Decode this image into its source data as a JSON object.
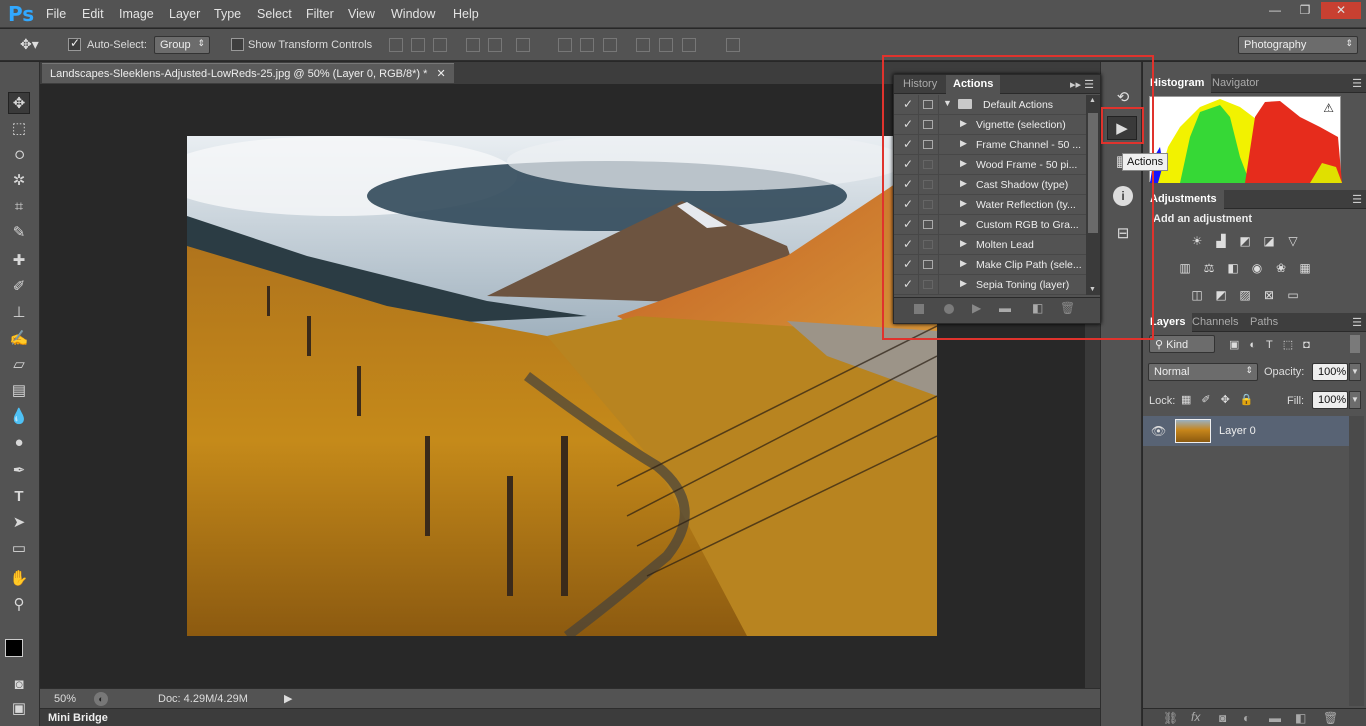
{
  "app": {
    "logo": "Ps",
    "window_controls": [
      "—",
      "❐",
      "✕"
    ]
  },
  "menubar": {
    "items": [
      "File",
      "Edit",
      "Image",
      "Layer",
      "Type",
      "Select",
      "Filter",
      "View",
      "Window",
      "Help"
    ]
  },
  "options": {
    "auto_select_label": "Auto-Select:",
    "auto_select_value": "Group",
    "transform_label": "Show Transform Controls",
    "workspace": "Photography"
  },
  "document": {
    "tab_title": "Landscapes-Sleeklens-Adjusted-LowReds-25.jpg @ 50% (Layer 0, RGB/8*) *",
    "zoom": "50%",
    "doc_info": "Doc: 4.29M/4.29M"
  },
  "bottom": {
    "mini_bridge": "Mini Bridge"
  },
  "actions_panel": {
    "tabs": [
      "History",
      "Actions"
    ],
    "set_name": "Default Actions",
    "items": [
      {
        "label": "Vignette (selection)",
        "dialog": true
      },
      {
        "label": "Frame Channel - 50 ...",
        "dialog": true
      },
      {
        "label": "Wood Frame - 50 pi...",
        "dialog": false
      },
      {
        "label": "Cast Shadow (type)",
        "dialog": false
      },
      {
        "label": "Water Reflection (ty...",
        "dialog": false
      },
      {
        "label": "Custom RGB to Gra...",
        "dialog": true
      },
      {
        "label": "Molten Lead",
        "dialog": false
      },
      {
        "label": "Make Clip Path (sele...",
        "dialog": true
      },
      {
        "label": "Sepia Toning (layer)",
        "dialog": false
      }
    ]
  },
  "dock": {
    "tooltip": "Actions"
  },
  "histogram": {
    "tabs": [
      "Histogram",
      "Navigator"
    ],
    "warning": "⚠"
  },
  "adjustments": {
    "tab": "Adjustments",
    "heading": "Add an adjustment"
  },
  "layers": {
    "tabs": [
      "Layers",
      "Channels",
      "Paths"
    ],
    "filter_kind": "Kind",
    "blend_mode": "Normal",
    "opacity_label": "Opacity:",
    "opacity_value": "100%",
    "lock_label": "Lock:",
    "fill_label": "Fill:",
    "fill_value": "100%",
    "layer_name": "Layer 0"
  },
  "colors": {
    "highlight": "#e0332d",
    "accent": "#31a8ff"
  }
}
